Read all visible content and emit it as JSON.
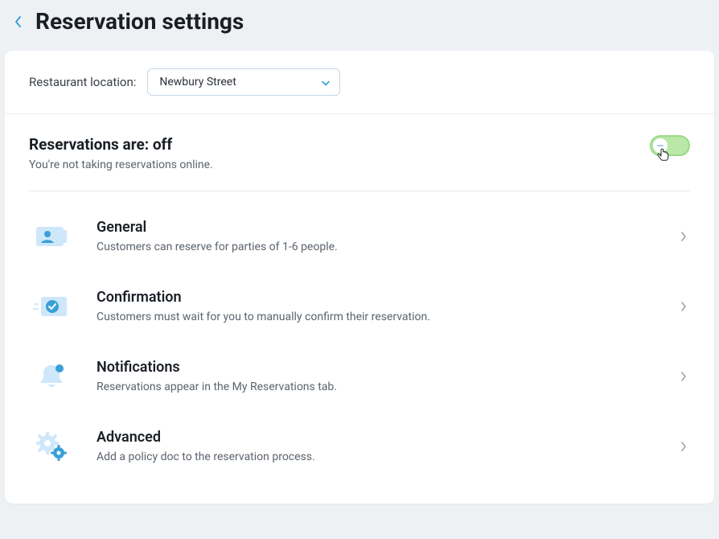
{
  "header": {
    "title": "Reservation settings"
  },
  "location": {
    "label": "Restaurant location:",
    "selected": "Newbury Street"
  },
  "status": {
    "heading": "Reservations are: off",
    "sub": "You're not taking reservations online.",
    "toggle_on": false
  },
  "rows": {
    "general": {
      "title": "General",
      "desc": "Customers can reserve for parties of 1-6 people."
    },
    "confirmation": {
      "title": "Confirmation",
      "desc": "Customers must wait for you to manually confirm their reservation."
    },
    "notifications": {
      "title": "Notifications",
      "desc": "Reservations appear in the My Reservations tab."
    },
    "advanced": {
      "title": "Advanced",
      "desc": "Add a policy doc to the reservation process."
    }
  }
}
